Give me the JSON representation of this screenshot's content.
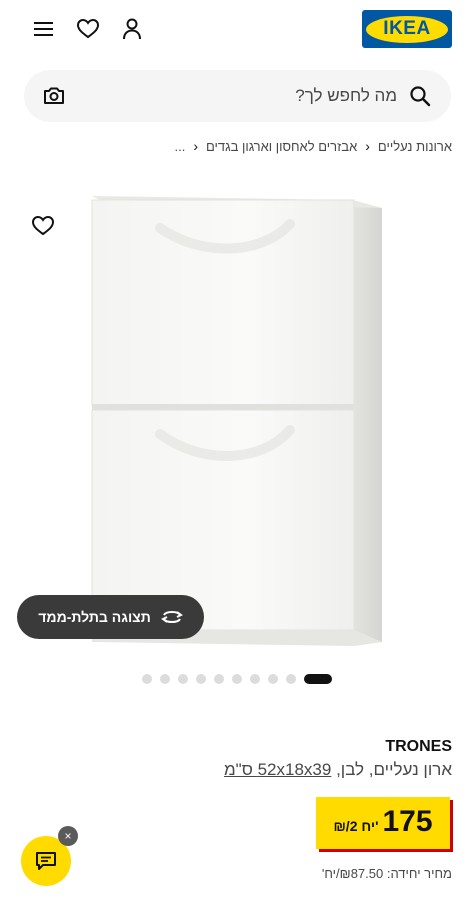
{
  "header": {
    "logo_text": "IKEA",
    "brand_colors": {
      "blue": "#0058a3",
      "yellow": "#ffdb00"
    },
    "icons": [
      "menu-icon",
      "heart-icon",
      "user-icon"
    ]
  },
  "search": {
    "placeholder": "מה לחפש לך?"
  },
  "breadcrumb": {
    "items": [
      "...",
      "אבזרים לאחסון וארגון בגדים",
      "ארונות נעליים"
    ]
  },
  "product_gallery": {
    "view_3d_label": "תצוגה בתלת-ממד",
    "dot_count": 10,
    "active_dot_index": 9
  },
  "product": {
    "name": "TRONES",
    "desc_prefix": "ארון נעליים, לבן,",
    "dimensions": "52x18x39 ס\"מ",
    "price_value": "175",
    "price_unit": "₪/2 יח'",
    "unit_price": "מחיר יחידה: ₪87.50/יח'"
  },
  "chat": {
    "close_label": "×"
  }
}
